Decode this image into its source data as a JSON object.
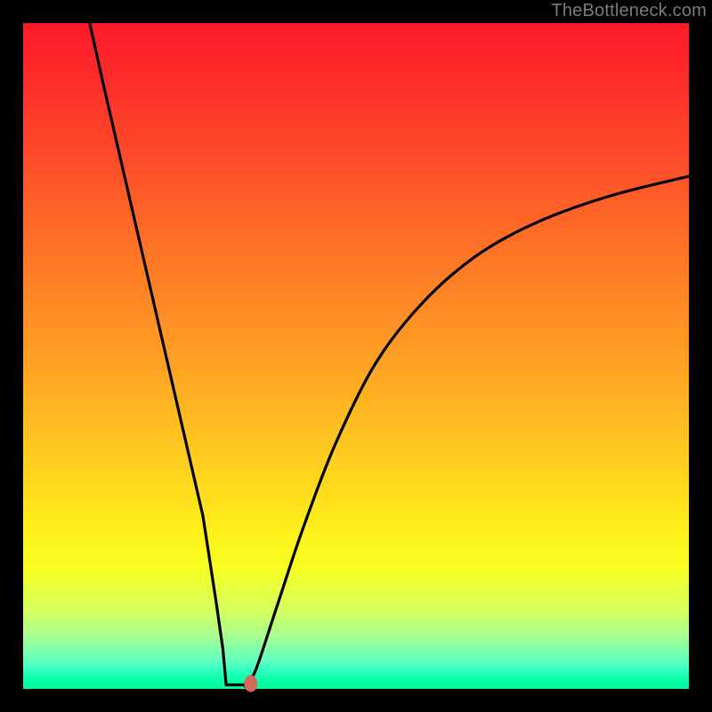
{
  "watermark": "TheBottleneck.com",
  "colors": {
    "page_bg": "#000000",
    "curve": "#000000",
    "marker": "#d6695e",
    "gradient_top": "#fc1a2a",
    "gradient_bottom": "#00ff92"
  },
  "chart_data": {
    "type": "line",
    "title": "",
    "xlabel": "",
    "ylabel": "",
    "xlim": [
      0,
      100
    ],
    "ylim": [
      0,
      100
    ],
    "note": "Axes are unlabeled in the source image; x/y are normalized 0–100 for the plotted area. The curve is a V-shaped bottleneck profile: steep linear descent, short flat trough, then asymptotic rise.",
    "series": [
      {
        "name": "bottleneck-curve",
        "x": [
          10,
          12,
          15,
          18,
          21,
          24,
          27,
          29,
          30,
          31,
          32,
          33.5,
          35,
          38,
          42,
          47,
          53,
          60,
          68,
          77,
          88,
          100
        ],
        "y": [
          100,
          91,
          78,
          65,
          52,
          39,
          26,
          13,
          6,
          1.5,
          0.5,
          0.5,
          3,
          12,
          24,
          37,
          49,
          58,
          65,
          70,
          74,
          77
        ]
      }
    ],
    "trough_segment": {
      "x_start": 30.5,
      "x_end": 33.5,
      "y": 0.6
    },
    "marker": {
      "x": 34.2,
      "y": 0.8
    }
  }
}
